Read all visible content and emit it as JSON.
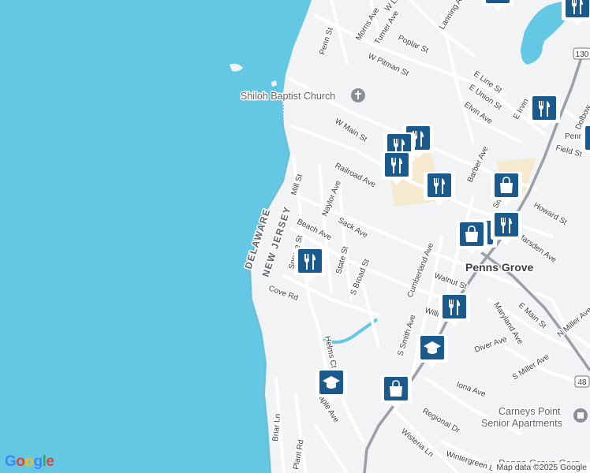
{
  "attribution": "Map data ©2025 Google",
  "logo": "Google",
  "colors": {
    "water": "#64c7e3",
    "land": "#f1f3f4",
    "road": "#ffffff",
    "major_road": "#9aa0a6",
    "marker": "#1a5a8c",
    "park": "#cfe9c6",
    "commercial": "#f5e9cf"
  },
  "labels": {
    "state_de": "DELAWARE",
    "state_nj": "NEW JERSEY",
    "church": "Shiloh Baptist Church",
    "town": "Penns Grove",
    "senior_1": "Carneys Point",
    "senior_2": "Senior Apartments",
    "penns_grove_carn": "Penns Grove Carn",
    "route_130": "130",
    "route_48": "48"
  },
  "streets": [
    "Morris Ave",
    "Turner Ave",
    "W Line St",
    "Poplar St",
    "Lanning Ave",
    "Penn St",
    "W Pitman St",
    "E Line St",
    "E Union St",
    "Elvin Ave",
    "W Main St",
    "Mill St",
    "Railroad Ave",
    "Naylor Ave",
    "Barber Ave",
    "Sack Ave",
    "Beach Ave",
    "State St",
    "Spruce St",
    "S Broad St",
    "Cumberland Ave",
    "E Main St",
    "Walnut St",
    "Cove Rd",
    "Helms Ct",
    "S Smith Ave",
    "Diver Ave",
    "Maryland Ave",
    "S Miller Ave",
    "N Miller Ave",
    "Iona Ave",
    "Regional Dr",
    "Wisteria Ln",
    "Wintergreen L",
    "Briar Ln",
    "Plant Rd",
    "Maple Ave",
    "Howard St",
    "Field St",
    "Dolbow",
    "Marsden Ave",
    "Smith Ave",
    "E Irvin",
    "Willi",
    "Penn"
  ],
  "markers": [
    {
      "type": "restaurant-icon"
    },
    {
      "type": "restaurant-icon"
    },
    {
      "type": "restaurant-icon"
    },
    {
      "type": "restaurant-icon"
    },
    {
      "type": "restaurant-icon"
    },
    {
      "type": "restaurant-icon"
    },
    {
      "type": "restaurant-icon"
    },
    {
      "type": "restaurant-icon"
    },
    {
      "type": "restaurant-icon"
    },
    {
      "type": "restaurant-icon"
    },
    {
      "type": "restaurant-icon"
    },
    {
      "type": "restaurant-icon"
    },
    {
      "type": "shopping-bag-icon"
    },
    {
      "type": "shopping-bag-icon"
    },
    {
      "type": "shopping-bag-icon"
    },
    {
      "type": "school-icon"
    },
    {
      "type": "school-icon"
    }
  ]
}
